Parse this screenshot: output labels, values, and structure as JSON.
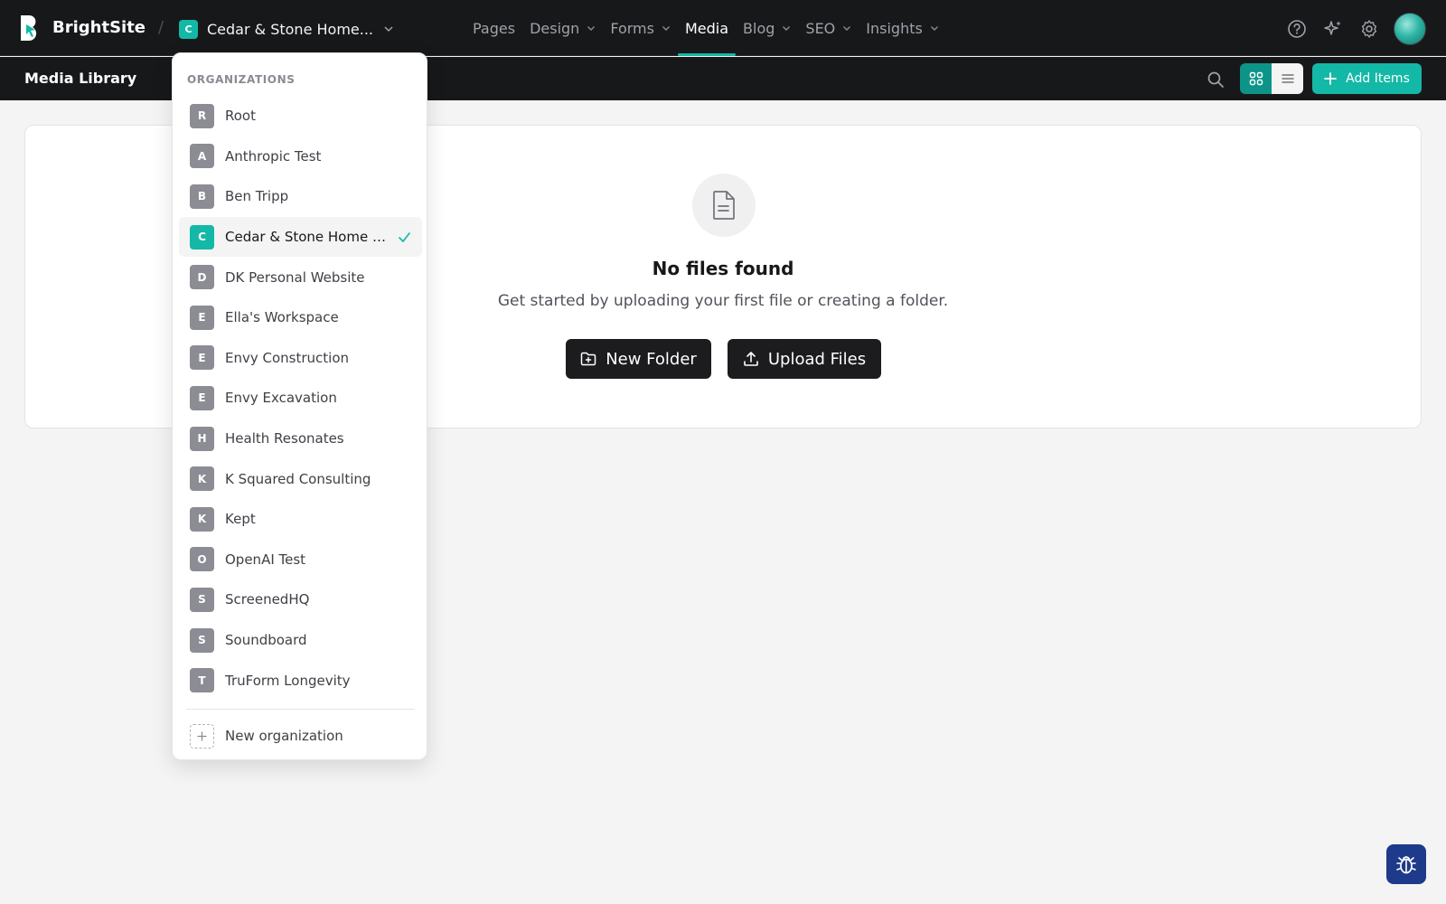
{
  "app": {
    "brand": "BrightSite",
    "current_org_initial": "C",
    "current_org_name": "Cedar & Stone Home...",
    "accent_color": "#14b8a6"
  },
  "nav": {
    "items": [
      {
        "label": "Pages",
        "has_menu": false,
        "active": false
      },
      {
        "label": "Design",
        "has_menu": true,
        "active": false
      },
      {
        "label": "Forms",
        "has_menu": true,
        "active": false
      },
      {
        "label": "Media",
        "has_menu": false,
        "active": true
      },
      {
        "label": "Blog",
        "has_menu": true,
        "active": false
      },
      {
        "label": "SEO",
        "has_menu": true,
        "active": false
      },
      {
        "label": "Insights",
        "has_menu": true,
        "active": false
      }
    ]
  },
  "header_icons": [
    "help-icon",
    "sparkles-icon",
    "gear-icon",
    "avatar"
  ],
  "subbar": {
    "title": "Media Library",
    "add_label": "Add Items",
    "view_mode": "grid"
  },
  "empty_state": {
    "title": "No files found",
    "subtitle": "Get started by uploading your first file or creating a folder.",
    "new_folder_label": "New Folder",
    "upload_label": "Upload Files"
  },
  "org_dropdown": {
    "heading": "ORGANIZATIONS",
    "items": [
      {
        "initial": "R",
        "name": "Root",
        "selected": false
      },
      {
        "initial": "A",
        "name": "Anthropic Test",
        "selected": false
      },
      {
        "initial": "B",
        "name": "Ben Tripp",
        "selected": false
      },
      {
        "initial": "C",
        "name": "Cedar & Stone Home S...",
        "selected": true
      },
      {
        "initial": "D",
        "name": "DK Personal Website",
        "selected": false
      },
      {
        "initial": "E",
        "name": "Ella's Workspace",
        "selected": false
      },
      {
        "initial": "E",
        "name": "Envy Construction",
        "selected": false
      },
      {
        "initial": "E",
        "name": "Envy Excavation",
        "selected": false
      },
      {
        "initial": "H",
        "name": "Health Resonates",
        "selected": false
      },
      {
        "initial": "K",
        "name": "K Squared Consulting",
        "selected": false
      },
      {
        "initial": "K",
        "name": "Kept",
        "selected": false
      },
      {
        "initial": "O",
        "name": "OpenAI Test",
        "selected": false
      },
      {
        "initial": "S",
        "name": "ScreenedHQ",
        "selected": false
      },
      {
        "initial": "S",
        "name": "Soundboard",
        "selected": false
      },
      {
        "initial": "T",
        "name": "TruForm Longevity",
        "selected": false
      }
    ],
    "new_label": "New organization"
  }
}
